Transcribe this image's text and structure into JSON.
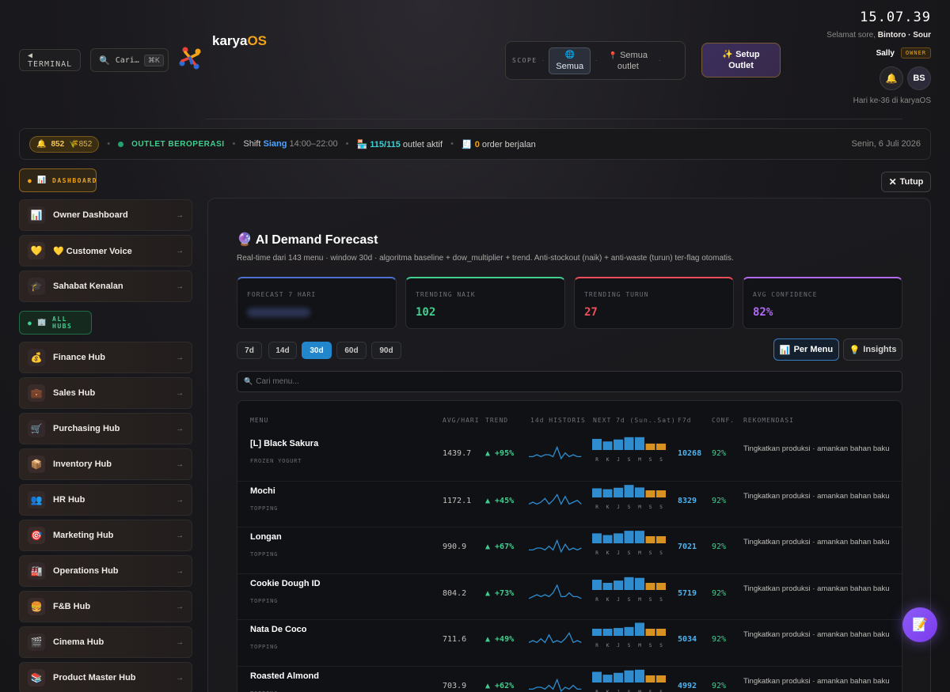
{
  "header": {
    "terminal_label": "◀ TERMINAL",
    "search_label": "Cari…",
    "search_kbd": "⌘K",
    "brand": "karya",
    "brand_os": "OS",
    "scope_label": "SCOPE",
    "scope_all": "Semua",
    "scope_outlet_line1": "Semua",
    "scope_outlet_line2": "outlet",
    "setup_line1": "✨ Setup",
    "setup_line2": "Outlet",
    "clock": "15.07.39",
    "greet_prefix": "Selamat sore,",
    "greet_name": "Bintoro · Sour",
    "user_name": "Sally",
    "role_badge": "OWNER",
    "avatar_initials": "BS",
    "day_count": "Hari ke-36 di karyaOS"
  },
  "statusbar": {
    "coins": "852",
    "coins_sub": "852",
    "outlet_status": "OUTLET BEROPERASI",
    "shift_prefix": "Shift",
    "shift_name": "Siang",
    "shift_time": "14:00–22:00",
    "outlet_active_count": "115/115",
    "outlet_active_label": "outlet aktif",
    "orders_count": "0",
    "orders_label": "order berjalan",
    "date": "Senin, 6 Juli 2026"
  },
  "sidebar": {
    "dashboard_section": "DASHBOARD",
    "hubs_section": "ALL HUBS",
    "dashboard_items": [
      {
        "label": "Owner Dashboard",
        "icon": "📊"
      },
      {
        "label": "💛 Customer Voice",
        "icon": "💛"
      },
      {
        "label": "Sahabat Kenalan",
        "icon": "🎓"
      }
    ],
    "hub_items": [
      {
        "label": "Finance Hub",
        "icon": "💰"
      },
      {
        "label": "Sales Hub",
        "icon": "💼"
      },
      {
        "label": "Purchasing Hub",
        "icon": "🛒"
      },
      {
        "label": "Inventory Hub",
        "icon": "📦"
      },
      {
        "label": "HR Hub",
        "icon": "👥"
      },
      {
        "label": "Marketing Hub",
        "icon": "🎯"
      },
      {
        "label": "Operations Hub",
        "icon": "🏭"
      },
      {
        "label": "F&B Hub",
        "icon": "🍔"
      },
      {
        "label": "Cinema Hub",
        "icon": "🎬"
      },
      {
        "label": "Product Master Hub",
        "icon": "📚"
      }
    ]
  },
  "close_label": "Tutup",
  "panel": {
    "title": "AI Demand Forecast",
    "title_icon": "🔮",
    "subtitle": "Real-time dari 143 menu · window 30d · algoritma baseline + dow_multiplier + trend. Anti-stockout (naik) + anti-waste (turun) ter-flag otomatis.",
    "kpis": [
      {
        "label": "FORECAST 7 HARI",
        "value": "",
        "color": "#4f6fd0"
      },
      {
        "label": "TRENDING NAIK",
        "value": "102",
        "color": "#3fcf8e"
      },
      {
        "label": "TRENDING TURUN",
        "value": "27",
        "color": "#ef4d5a"
      },
      {
        "label": "AVG CONFIDENCE",
        "value": "82%",
        "color": "#b36af5"
      }
    ],
    "periods": [
      "7d",
      "14d",
      "30d",
      "60d",
      "90d"
    ],
    "active_period": "30d",
    "view_menu": "Per Menu",
    "view_insights": "Insights",
    "search_placeholder": "Cari menu...",
    "columns": {
      "menu": "MENU",
      "avg": "AVG/HARI",
      "trend": "TREND",
      "history": "14d HISTORIS",
      "next": "NEXT 7d (Sun..Sat)",
      "f7d": "F7d",
      "conf": "CONF.",
      "rec": "REKOMENDASI"
    },
    "day_letters": [
      "R",
      "K",
      "J",
      "S",
      "M",
      "S",
      "S"
    ],
    "rows": [
      {
        "name": "[L] Black Sakura",
        "category": "FROZEN YOGURT",
        "avg": "1439.7",
        "trend": "▲ +95%",
        "f7d": "10268",
        "conf": "92%",
        "rec": "Tingkatkan produksi · amankan bahan baku",
        "next7": [
          0.78,
          0.6,
          0.74,
          0.9,
          0.9,
          0.45,
          0.45
        ]
      },
      {
        "name": "Mochi",
        "category": "TOPPING",
        "avg": "1172.1",
        "trend": "▲ +45%",
        "f7d": "8329",
        "conf": "92%",
        "rec": "Tingkatkan produksi · amankan bahan baku",
        "next7": [
          0.64,
          0.58,
          0.68,
          0.88,
          0.7,
          0.5,
          0.5
        ]
      },
      {
        "name": "Longan",
        "category": "TOPPING",
        "avg": "990.9",
        "trend": "▲ +67%",
        "f7d": "7021",
        "conf": "92%",
        "rec": "Tingkatkan produksi · amankan bahan baku",
        "next7": [
          0.7,
          0.58,
          0.7,
          0.88,
          0.88,
          0.5,
          0.5
        ]
      },
      {
        "name": "Cookie Dough ID",
        "category": "TOPPING",
        "avg": "804.2",
        "trend": "▲ +73%",
        "f7d": "5719",
        "conf": "92%",
        "rec": "Tingkatkan produksi · amankan bahan baku",
        "next7": [
          0.72,
          0.5,
          0.66,
          0.9,
          0.85,
          0.5,
          0.5
        ]
      },
      {
        "name": "Nata De Coco",
        "category": "TOPPING",
        "avg": "711.6",
        "trend": "▲ +49%",
        "f7d": "5034",
        "conf": "92%",
        "rec": "Tingkatkan produksi · amankan bahan baku",
        "next7": [
          0.5,
          0.5,
          0.55,
          0.62,
          0.92,
          0.5,
          0.5
        ]
      },
      {
        "name": "Roasted Almond",
        "category": "TOPPING",
        "avg": "703.9",
        "trend": "▲ +62%",
        "f7d": "4992",
        "conf": "92%",
        "rec": "Tingkatkan produksi · amankan bahan baku",
        "next7": [
          0.75,
          0.55,
          0.68,
          0.85,
          0.9,
          0.5,
          0.5
        ]
      }
    ]
  },
  "colors": {
    "accent_orange": "#f2a416",
    "accent_blue": "#2186cc",
    "bar_blue": "#2e8ccf",
    "bar_orange": "#d89222",
    "fab_purple": "#8b5cf6"
  },
  "icons": {
    "search": "search-icon",
    "bell": "bell-icon",
    "globe": "globe-icon",
    "pin": "pin-icon",
    "close": "close-icon",
    "fab": "notes-icon"
  }
}
